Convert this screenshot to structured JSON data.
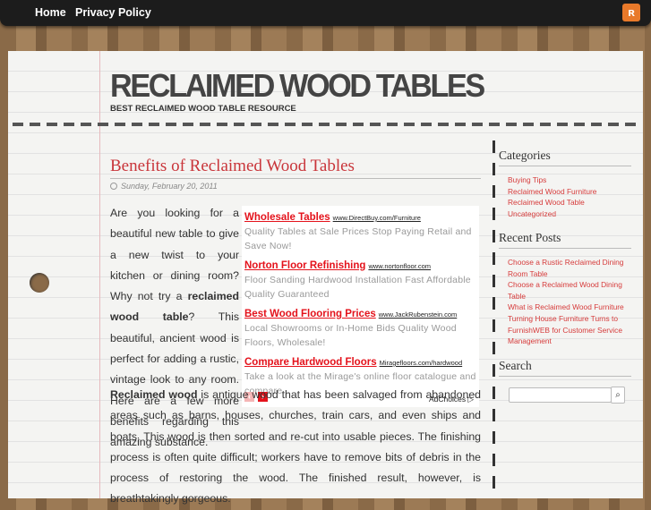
{
  "nav": {
    "home": "Home",
    "privacy": "Privacy Policy",
    "rss_icon": "rss-icon"
  },
  "site": {
    "title": "RECLAIMED WOOD TABLES",
    "tagline": "BEST RECLAIMED WOOD TABLE RESOURCE"
  },
  "post": {
    "title": "Benefits of Reclaimed Wood Tables",
    "date": "Sunday, February 20, 2011",
    "p1_a": "Are you looking for a beautiful new table to give a new twist to your kitchen or dining room? Why not try a ",
    "p1_bold": "reclaimed wood table",
    "p1_b": "? This beautiful, ancient wood is perfect for adding a rustic, vintage look to any room. Here are a few more benefits regarding this amazing substance.",
    "p2_bold": "Reclaimed wood",
    "p2": " is antique wood that has been salvaged from abandoned areas such as barns, houses, churches, train cars, and even ships and boats. This wood is then sorted and re-cut into usable pieces. The finishing process is often quite difficult; workers have to remove bits of debris in the process of restoring the wood. The finished result, however, is breathtakingly gorgeous."
  },
  "ads": [
    {
      "headline": "Wholesale Tables",
      "url": "www.DirectBuy.com/Furniture",
      "desc": "Quality Tables at Sale Prices Stop Paying Retail and Save Now!"
    },
    {
      "headline": "Norton Floor Refinishing",
      "url": "www.nortonfloor.com",
      "desc": "Floor Sanding Hardwood Installation Fast Affordable Quality Guaranteed"
    },
    {
      "headline": "Best Wood Flooring Prices",
      "url": "www.JackRubenstein.com",
      "desc": "Local Showrooms or In-Home Bids Quality Wood Floors, Wholesale!"
    },
    {
      "headline": "Compare Hardwood Floors",
      "url": "Miragefloors.com/hardwood",
      "desc": "Take a look at the Mirage's online floor catalogue and compare"
    }
  ],
  "ad_prev": "‹",
  "ad_next": "›",
  "adchoices": "AdChoices ▷",
  "sidebar": {
    "categories_title": "Categories",
    "categories": [
      "Buying Tips",
      "Reclaimed Wood Furniture",
      "Reclaimed Wood Table",
      "Uncategorized"
    ],
    "recent_title": "Recent Posts",
    "recent": [
      "Choose a Rustic Reclaimed Dining Room Table",
      "Choose a Reclaimed Wood Dining Table",
      "What is Reclaimed Wood Furniture",
      "Turning House Furniture Turns to FurnishWEB for Customer Service Management"
    ],
    "search_title": "Search",
    "search_value": "",
    "search_icon": "⌕"
  }
}
